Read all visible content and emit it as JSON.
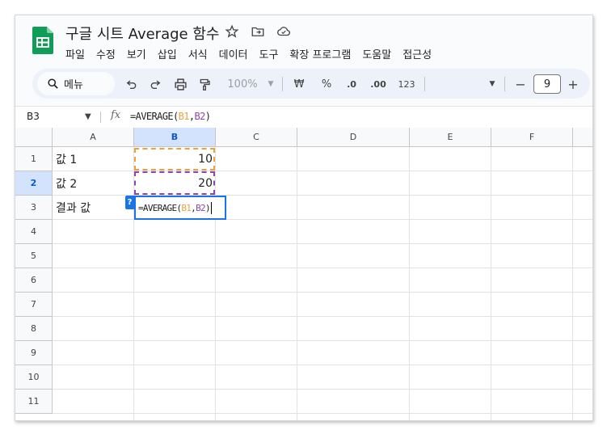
{
  "doc": {
    "title": "구글 시트 Average 함수"
  },
  "menu": [
    "파일",
    "수정",
    "보기",
    "삽입",
    "서식",
    "데이터",
    "도구",
    "확장 프로그램",
    "도움말",
    "접근성"
  ],
  "toolbar": {
    "search_label": "메뉴",
    "zoom": "100%",
    "currency": "₩",
    "percent": "%",
    "dec_decrease": ".0",
    "dec_increase": ".00",
    "number_format": "123",
    "font_size": "9",
    "minus": "−",
    "plus": "+"
  },
  "formula_bar": {
    "name_box": "B3",
    "fx": "fx",
    "formula_prefix": "=AVERAGE(",
    "ref1": "B1",
    "comma": ",",
    "ref2": "B2",
    "close": ")"
  },
  "grid": {
    "columns": [
      "A",
      "B",
      "C",
      "D",
      "E",
      "F"
    ],
    "rows": [
      "1",
      "2",
      "3",
      "4",
      "5",
      "6",
      "7",
      "8",
      "9",
      "10",
      "11"
    ],
    "cells": {
      "A1": "값 1",
      "A2": "값 2",
      "A3": "결과 값",
      "B1": "10",
      "B2": "20"
    },
    "editor_help": "?"
  },
  "colors": {
    "ref1": "#e8a33d",
    "ref2": "#8e44ad",
    "selection": "#1a73e8",
    "header_selected": "#d3e3fd",
    "sheets_green": "#0f9d58"
  }
}
